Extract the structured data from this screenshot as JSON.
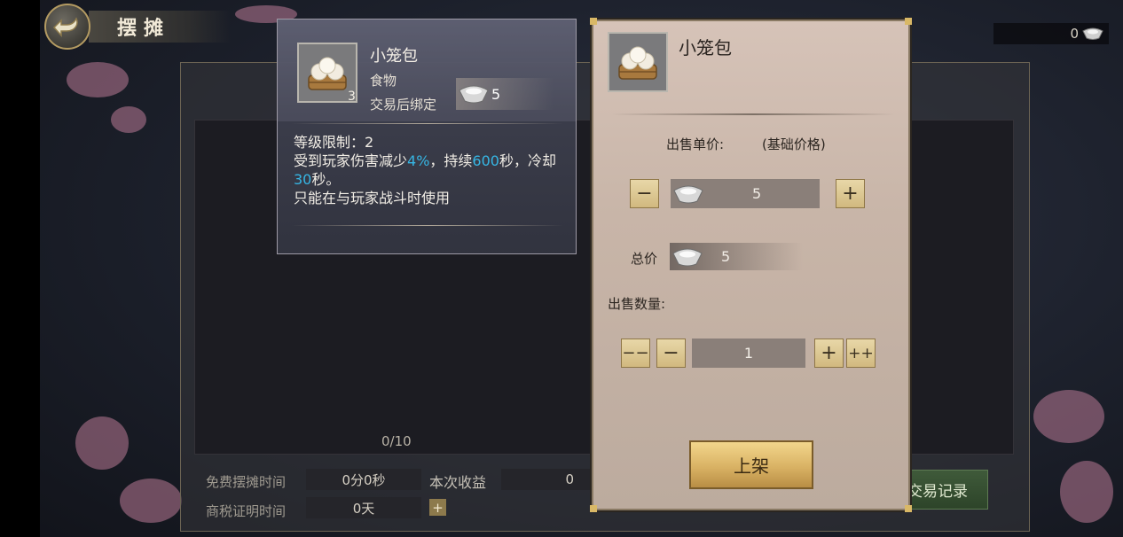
{
  "header": {
    "title": "摆摊"
  },
  "currency": {
    "amount": "0",
    "icon": "silver-ingot-icon"
  },
  "stall": {
    "slot_count": "0/10"
  },
  "bottom": {
    "free_time_label": "免费摆摊时间",
    "free_time_value": "0分0秒",
    "earnings_label": "本次收益",
    "earnings_value": "0",
    "tax_label": "商税证明时间",
    "tax_value": "0天",
    "tax_add": "+",
    "record_label": "交易记录"
  },
  "tooltip": {
    "name": "小笼包",
    "type": "食物",
    "bind": "交易后绑定",
    "quantity": "3",
    "price": "5",
    "desc_level": "等级限制：2",
    "desc_1": "受到玩家伤害减少",
    "desc_pct": "4%",
    "desc_2": "，持续",
    "desc_dur": "600",
    "desc_3": "秒，冷却",
    "desc_cd": "30",
    "desc_4": "秒。",
    "desc_line3": "只能在与玩家战斗时使用"
  },
  "sell": {
    "name": "小笼包",
    "unit_price_label": "出售单价:",
    "base_price_label": "(基础价格)",
    "unit_price": "5",
    "minus": "−",
    "plus": "+",
    "total_label": "总价",
    "total": "5",
    "qty_label": "出售数量:",
    "qty_min": "−−",
    "qty_minus": "−",
    "qty": "1",
    "qty_plus": "+",
    "qty_max": "++",
    "list_label": "上架"
  },
  "colors": {
    "highlight": "#36b6e4",
    "gold_button": "#d9b264"
  }
}
